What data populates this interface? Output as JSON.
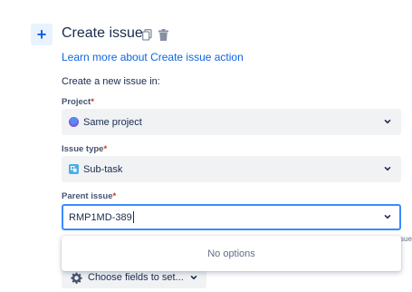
{
  "header": {
    "plus_symbol": "+",
    "title": "Create issue",
    "copy_icon": "copy-icon",
    "delete_icon": "trash-icon"
  },
  "learn_more_link": "Learn more about Create issue action",
  "intro_text": "Create a new issue in:",
  "fields": {
    "project": {
      "label": "Project",
      "required": "*",
      "value": "Same project"
    },
    "issue_type": {
      "label": "Issue type",
      "required": "*",
      "value": "Sub-task"
    },
    "parent_issue": {
      "label": "Parent issue",
      "required": "*",
      "value": "RMP1MD-389"
    }
  },
  "dropdown": {
    "empty_text": "No options"
  },
  "behind_text": "sue",
  "choose_fields_button": "Choose fields to set...",
  "colors": {
    "accent": "#0c66e4",
    "focus_border": "#388bff",
    "required": "#c9372c",
    "field_bg": "#f1f2f4"
  }
}
